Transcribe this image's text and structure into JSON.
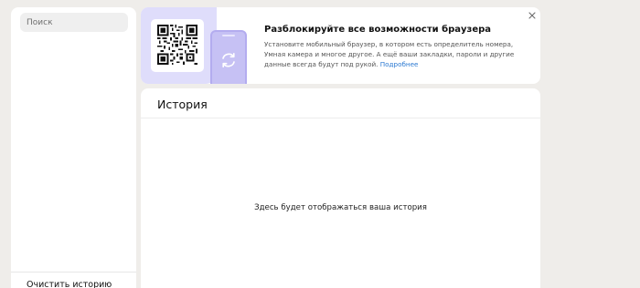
{
  "sidebar": {
    "search": {
      "placeholder": "Поиск",
      "value": ""
    },
    "clear_history_label": "Очистить историю"
  },
  "promo": {
    "title": "Разблокируйте все возможности браузера",
    "text": "Установите мобильный браузер, в котором есть определитель номера, Умная камера и многое другое. А ещё ваши закладки, пароли и другие данные всегда будут под рукой.",
    "link_label": "Подробнее",
    "close_icon": "close-icon",
    "qr_icon": "qr-code-icon",
    "sync_icon": "sync-icon"
  },
  "history": {
    "title": "История",
    "empty_message": "Здесь будет отображаться ваша история"
  },
  "colors": {
    "page_background": "#efedea",
    "card_background": "#ffffff",
    "promo_art_background": "#dfddfb",
    "phone_fill": "#c6c1f4",
    "link": "#2a78d1"
  }
}
